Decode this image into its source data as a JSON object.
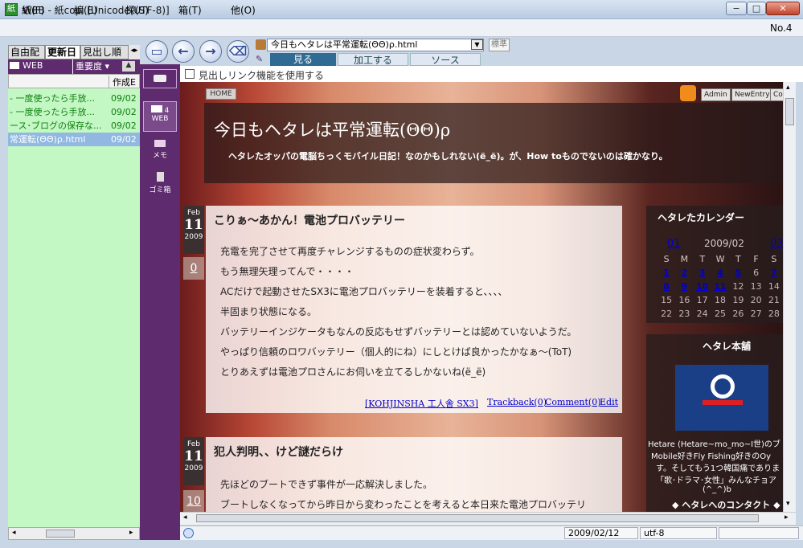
{
  "window": {
    "title": "WEB - 紙copi [Unicode(UTF-8)]",
    "icon_label": "紙",
    "min": "−",
    "max": "□",
    "close": "✕"
  },
  "menu": [
    "紙(F)",
    "編(E)",
    "探(S)",
    "箱(T)",
    "他(O)"
  ],
  "doc_number": "No.4",
  "left_tabs": [
    "自由配",
    "更新日",
    "見出し順"
  ],
  "left_header": {
    "folder": "WEB",
    "sort": "重要度",
    "arrow": "▾"
  },
  "left_columns": {
    "created": "作成E"
  },
  "left_list": [
    {
      "title": "- 一度使ったら手放...",
      "date": "09/02"
    },
    {
      "title": "- 一度使ったら手放...",
      "date": "09/02"
    },
    {
      "title": "ース･ブログの保存な...",
      "date": "09/02"
    },
    {
      "title": "常運転(ΘΘ)ρ.html",
      "date": "09/02",
      "selected": true
    }
  ],
  "folders": [
    {
      "label": "",
      "icon": "eraser-icon"
    },
    {
      "label": "WEB",
      "count": "4",
      "icon": "envelope-icon"
    },
    {
      "label": "メモ",
      "icon": "memo-icon"
    },
    {
      "label": "ゴミ箱",
      "icon": "trash-icon"
    }
  ],
  "toolbar": {
    "url": "今日もヘタレは平常運転(ΘΘ)ρ.html",
    "standard": "標準"
  },
  "view_tabs": [
    "見る",
    "加工する",
    "ソース"
  ],
  "link_option": "見出しリンク機能を使用する",
  "blog": {
    "home": "HOME",
    "header_buttons": [
      "Admin",
      "NewEntry",
      "Co"
    ],
    "title": "今日もヘタレは平常運転(ΘΘ)ρ",
    "subtitle": "ヘタレたオッパの電脳ちっくモバイル日記！なのかもしれない(ë_ë)。が、How toものでないのは確かなり。",
    "posts": [
      {
        "month": "Feb",
        "day": "11",
        "year": "2009",
        "comments": "0",
        "title": "こりぁ～あかん！電池プロバッテリー",
        "lines": [
          "充電を完了させて再度チャレンジするものの症状変わらず。",
          "もう無理矢理ってんで・・・・",
          "ACだけで起動させたSX3に電池プロバッテリーを装着すると、、、、",
          "半固まり状態になる。",
          "バッテリーインジケータもなんの反応もせずバッテリーとは認めていないようだ。",
          "やっぱり信頼のロワバッテリー（個人的にね）にしとけば良かったかなぁ～(ToT)",
          "とりあえずは電池プロさんにお伺いを立てるしかないね(ë_ë)"
        ],
        "category": "[KOHJINSHA 工人舎 SX3]",
        "trackback": "Trackback(0)",
        "comment": "Comment(0)",
        "edit": "Edit"
      },
      {
        "month": "Feb",
        "day": "11",
        "year": "2009",
        "comments": "10",
        "title": "犯人判明、、けど謎だらけ",
        "lines": [
          "先ほどのブートできず事件が一応解決しました。",
          "ブートしなくなってから昨日から変わったことを考えると本日来た電池プロバッテリ"
        ]
      }
    ],
    "calendar": {
      "title": "ヘタレたカレンダー",
      "prev": "01",
      "month": "2009/02",
      "next": "03",
      "weekdays": [
        "S",
        "M",
        "T",
        "W",
        "T",
        "F",
        "S"
      ],
      "rows": [
        [
          "1",
          "2",
          "3",
          "4",
          "5",
          "6",
          "7"
        ],
        [
          "8",
          "9",
          "10",
          "11",
          "12",
          "13",
          "14"
        ],
        [
          "15",
          "16",
          "17",
          "18",
          "19",
          "20",
          "21"
        ],
        [
          "22",
          "23",
          "24",
          "25",
          "26",
          "27",
          "28"
        ]
      ]
    },
    "shop": {
      "title": "ヘタレ本舗",
      "desc1": "Hetare (Hetare~mo_mo~Ⅰ世)のブ",
      "desc2": "Mobile好きFly Fishing好きのOy",
      "desc3": "す。そしてもう1つ韓国痛でありま",
      "desc4": "「歌･ドラマ･女性」みんなチョア",
      "desc5": "(^_^)b",
      "contact": "◆ ヘタレへのコンタクト ◆"
    }
  },
  "status": {
    "date": "2009/02/12",
    "encoding": "utf-8"
  }
}
